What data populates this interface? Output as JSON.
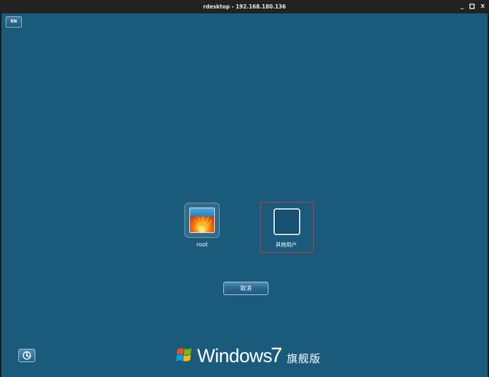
{
  "window": {
    "title": "rdesktop - 192.168.180.136",
    "controls": {
      "minimize": "_",
      "maximize": "□",
      "close": "x"
    }
  },
  "colors": {
    "desktop_bg": "#1a5b7c",
    "titlebar_bg": "#222222",
    "selection_border": "#c43a3a"
  },
  "language_indicator": {
    "label": "EN",
    "icon": "keyboard-layout-icon"
  },
  "users": [
    {
      "name": "root",
      "icon": "flower-avatar-icon"
    },
    {
      "name": "其他用户",
      "icon": "blank-avatar-icon"
    }
  ],
  "cancel_button": {
    "label": "取消"
  },
  "power_button": {
    "icon": "ease-of-access-icon"
  },
  "branding": {
    "product": "Windows",
    "version": "7",
    "edition": "旗舰版",
    "icon": "windows-flag-icon"
  }
}
